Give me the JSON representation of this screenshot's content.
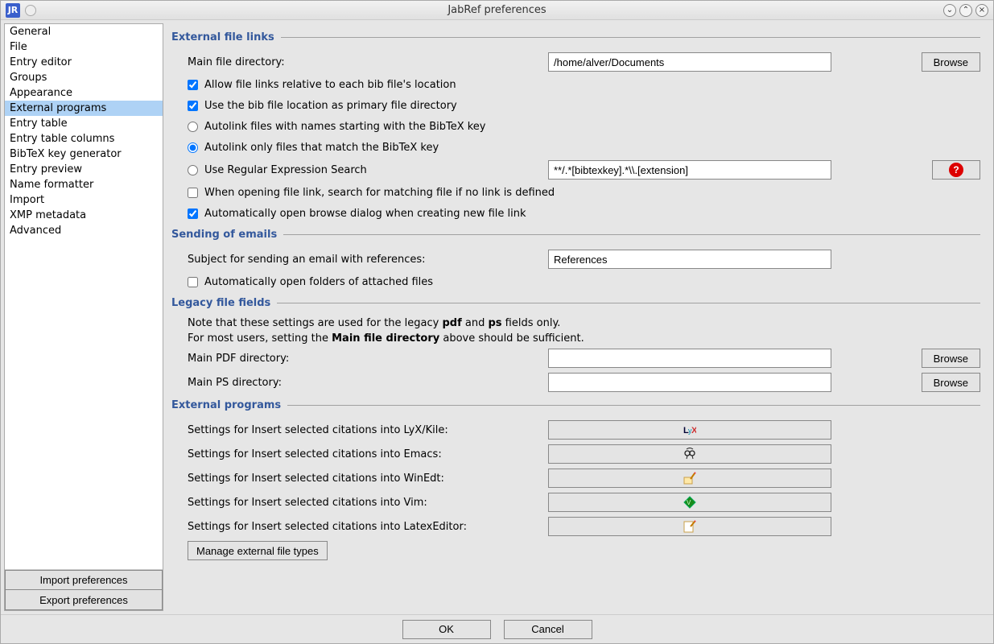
{
  "window": {
    "title": "JabRef preferences"
  },
  "sidebar": {
    "items": [
      "General",
      "File",
      "Entry editor",
      "Groups",
      "Appearance",
      "External programs",
      "Entry table",
      "Entry table columns",
      "BibTeX key generator",
      "Entry preview",
      "Name formatter",
      "Import",
      "XMP metadata",
      "Advanced"
    ],
    "selected_index": 5,
    "import_btn": "Import preferences",
    "export_btn": "Export preferences"
  },
  "sections": {
    "external_links": {
      "title": "External file links",
      "main_dir_label": "Main file directory:",
      "main_dir_value": "/home/alver/Documents",
      "browse": "Browse",
      "chk_relative": "Allow file links relative to each bib file's location",
      "chk_primary": "Use the bib file location as primary file directory",
      "radio_start": "Autolink files with names starting with the BibTeX key",
      "radio_match": "Autolink only files that match the BibTeX key",
      "radio_regex": "Use Regular Expression Search",
      "regex_value": "**/.*[bibtexkey].*\\\\.[extension]",
      "chk_search_match": "When opening file link, search for matching file if no link is defined",
      "chk_auto_browse": "Automatically open browse dialog when creating new file link"
    },
    "emails": {
      "title": "Sending of emails",
      "subject_label": "Subject for sending an email with references:",
      "subject_value": "References",
      "chk_open_folders": "Automatically open folders of attached files"
    },
    "legacy": {
      "title": "Legacy file fields",
      "note1_a": "Note that these settings are used for the legacy ",
      "note1_b": "pdf",
      "note1_c": " and ",
      "note1_d": "ps",
      "note1_e": " fields only.",
      "note2_a": "For most users, setting the ",
      "note2_b": "Main file directory",
      "note2_c": " above should be sufficient.",
      "pdf_label": "Main PDF directory:",
      "ps_label": "Main PS directory:",
      "browse": "Browse"
    },
    "programs": {
      "title": "External programs",
      "lyx_label": "Settings for Insert selected citations into LyX/Kile:",
      "emacs_label": "Settings for Insert selected citations into Emacs:",
      "winedt_label": "Settings for Insert selected citations into WinEdt:",
      "vim_label": "Settings for Insert selected citations into Vim:",
      "latex_label": "Settings for Insert selected citations into LatexEditor:",
      "manage_btn": "Manage external file types"
    }
  },
  "footer": {
    "ok": "OK",
    "cancel": "Cancel"
  }
}
